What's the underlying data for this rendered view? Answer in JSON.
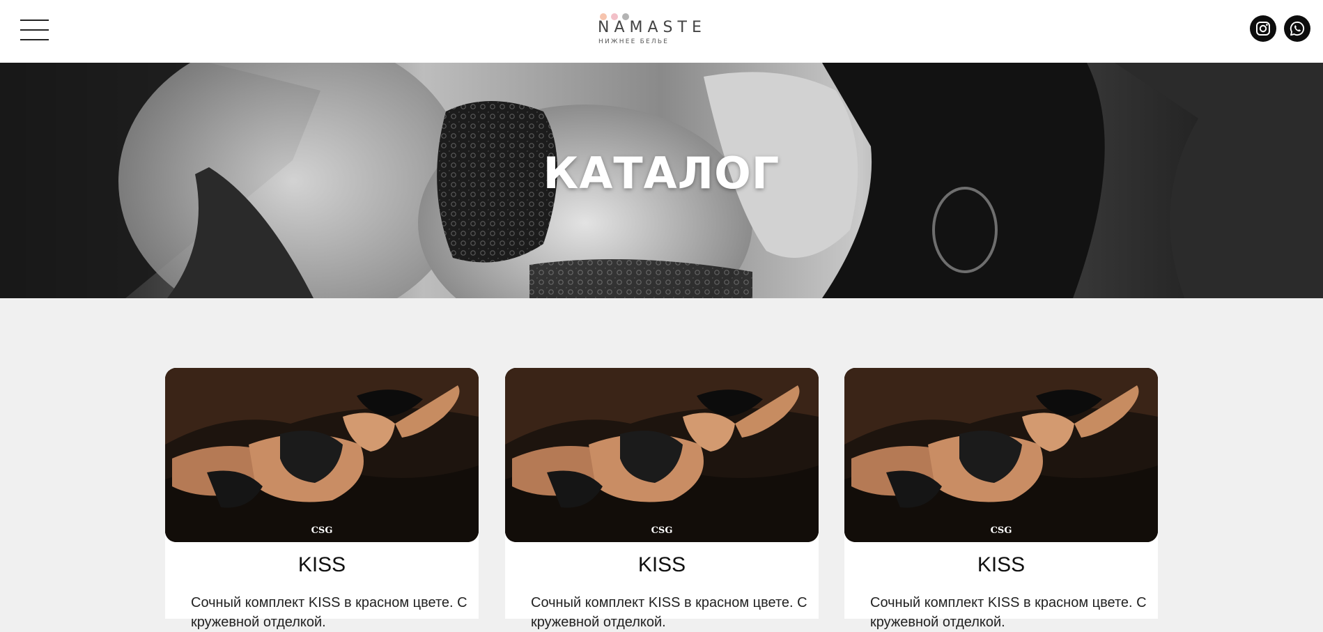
{
  "header": {
    "menu_icon": "hamburger-menu-icon",
    "logo": {
      "brand": "NAMASTE",
      "tagline": "НИЖНЕЕ БЕЛЬЕ",
      "dot_colors": [
        "#f6c4ae",
        "#f2c0c8",
        "#b3b3b3"
      ]
    },
    "social": [
      {
        "icon": "instagram-icon"
      },
      {
        "icon": "whatsapp-icon"
      }
    ]
  },
  "hero": {
    "title": "КАТАЛОГ"
  },
  "products": [
    {
      "title": "KISS",
      "description": "Сочный комплект KISS в красном цвете. С кружевной отделкой.",
      "watermark": "CSG"
    },
    {
      "title": "KISS",
      "description": "Сочный комплект KISS в красном цвете. С кружевной отделкой.",
      "watermark": "CSG"
    },
    {
      "title": "KISS",
      "description": "Сочный комплект KISS в красном цвете. С кружевной отделкой.",
      "watermark": "CSG"
    }
  ],
  "colors": {
    "page_background": "#f0f0f0",
    "header_background": "#ffffff",
    "text": "#111111",
    "social_button": "#0d0d0d"
  }
}
